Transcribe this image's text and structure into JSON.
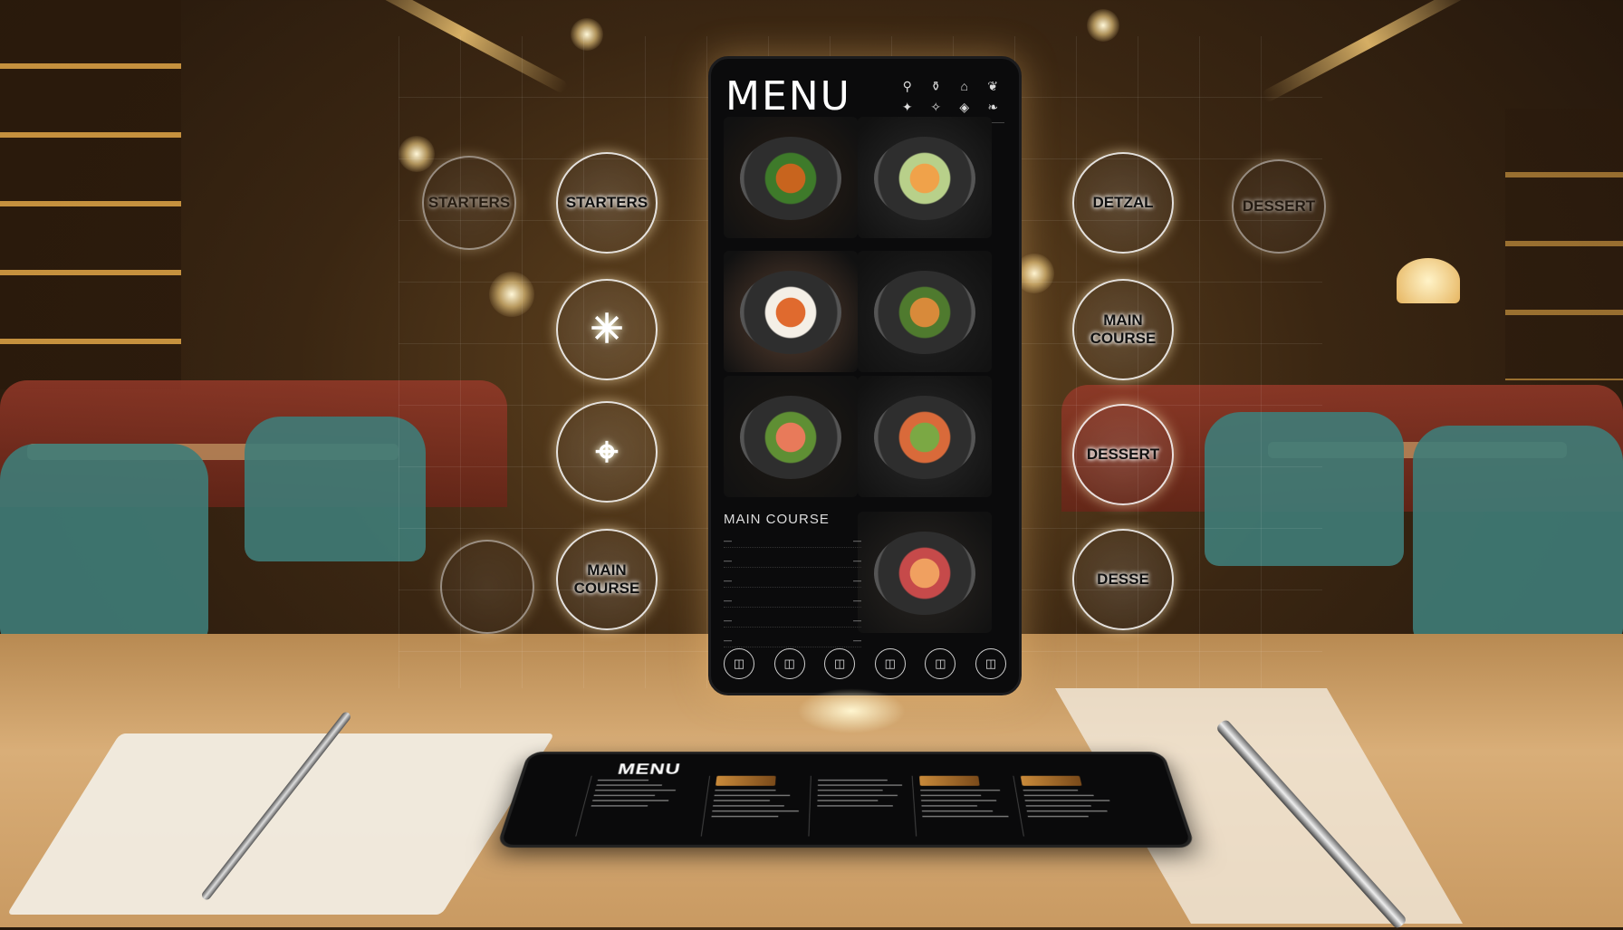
{
  "phone": {
    "title": "MENU",
    "header_icons": [
      "bottle-icon",
      "cup-icon",
      "glass-icon",
      "leaf-icon",
      "pepper-icon",
      "fire-icon",
      "steak-icon",
      "wine-icon"
    ],
    "dishes": [
      {
        "name": "fried-ball-salad",
        "colors": [
          "#c8641e",
          "#3e7a2a",
          "#2a1f16"
        ]
      },
      {
        "name": "peach-slices-plate",
        "colors": [
          "#f0a24a",
          "#b8d08a",
          "#2b2b2b"
        ]
      },
      {
        "name": "tomato-soup-bowl",
        "colors": [
          "#e06a2e",
          "#f4efe6",
          "#5a4030"
        ]
      },
      {
        "name": "croquettes-plate",
        "colors": [
          "#d88a3a",
          "#4f7a2e",
          "#232323"
        ]
      },
      {
        "name": "salmon-rose-salad",
        "colors": [
          "#e87a5a",
          "#5f8f34",
          "#1f1a15"
        ]
      },
      {
        "name": "herb-garnish-plate",
        "colors": [
          "#7ba844",
          "#d96a3a",
          "#2a2a2a"
        ]
      },
      {
        "name": "salmon-fig-plate",
        "colors": [
          "#f0a060",
          "#c64a4a",
          "#2a2622"
        ]
      }
    ],
    "main_course_panel": {
      "title": "MAIN COURSE",
      "rows": [
        {
          "label": "—",
          "price": "—"
        },
        {
          "label": "—",
          "price": "—"
        },
        {
          "label": "—",
          "price": "—"
        },
        {
          "label": "—",
          "price": "—"
        },
        {
          "label": "—",
          "price": "—"
        },
        {
          "label": "—",
          "price": "—"
        }
      ]
    },
    "nav": [
      "◫",
      "◫",
      "◫",
      "◫",
      "◫",
      "◫"
    ]
  },
  "holo_left": [
    {
      "label": "STARTERS",
      "faint": true
    },
    {
      "label": "STARTERS",
      "faint": false
    },
    {
      "label": "",
      "glyph": "✳",
      "faint": false
    },
    {
      "label": "",
      "glyph": "⌖",
      "faint": false
    },
    {
      "label": "",
      "faint": true
    },
    {
      "label": "MAIN\nCOURSE",
      "faint": false
    }
  ],
  "holo_right": [
    {
      "label": "DETZAL",
      "faint": false
    },
    {
      "label": "DESSERT",
      "faint": true
    },
    {
      "label": "MAIN\nCOURSE",
      "faint": false
    },
    {
      "label": "DESSERT",
      "faint": false
    },
    {
      "label": "DESSE",
      "faint": false
    }
  ],
  "tablet": {
    "title": "MENU"
  },
  "colors": {
    "phone_bg": "#0b0b0c",
    "accent_glow": "#ffd27a",
    "holo_line": "#ffffff"
  }
}
